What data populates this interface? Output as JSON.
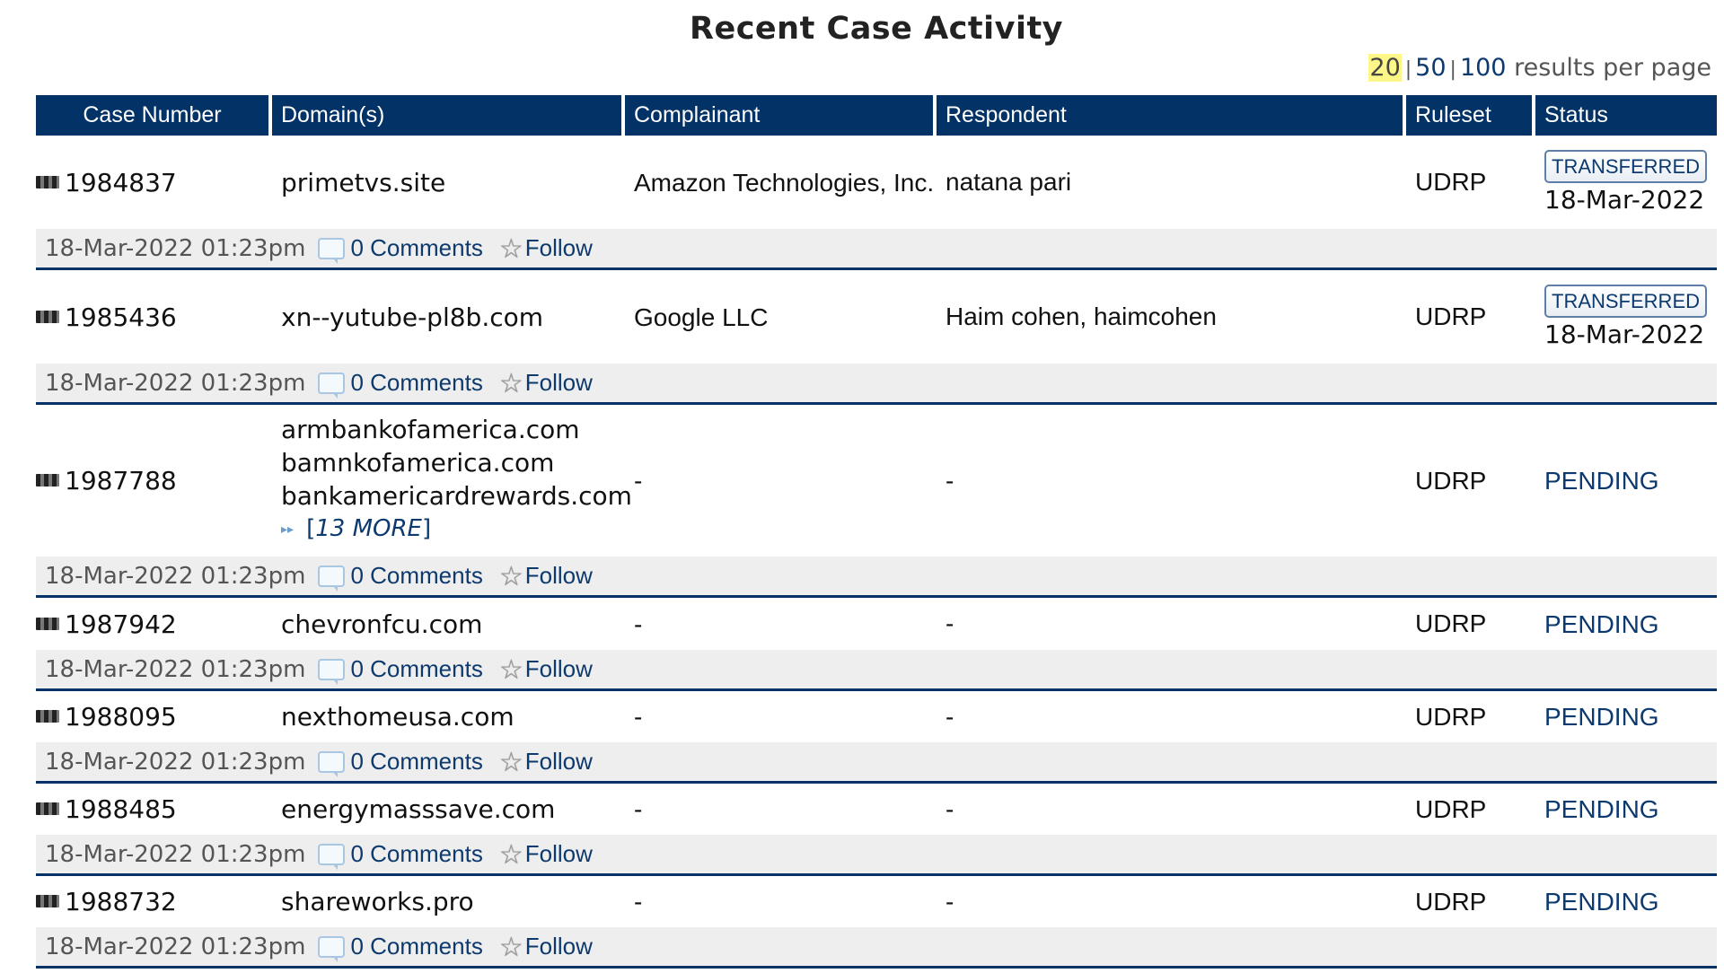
{
  "page": {
    "title": "Recent Case Activity"
  },
  "pagination": {
    "current": "20",
    "options": [
      "50",
      "100"
    ],
    "separator": "|",
    "suffix": "results per page",
    "highlight_color": "#fdf78a"
  },
  "table": {
    "headers": {
      "case_number": "Case Number",
      "domains": "Domain(s)",
      "complainant": "Complainant",
      "respondent": "Respondent",
      "ruleset": "Ruleset",
      "status": "Status"
    },
    "header_color": "#033366",
    "rows": [
      {
        "case_number": "1984837",
        "domains": [
          "primetvs.site"
        ],
        "more": null,
        "complainant": "Amazon Technologies, Inc.",
        "respondent": "natana pari",
        "ruleset": "UDRP",
        "status": "TRANSFERRED",
        "status_date": "18-Mar-2022",
        "timestamp": "18-Mar-2022 01:23pm",
        "comments": "0 Comments",
        "follow": "Follow"
      },
      {
        "case_number": "1985436",
        "domains": [
          "xn--yutube-pl8b.com"
        ],
        "more": null,
        "complainant": "Google LLC",
        "respondent": "Haim cohen, haimcohen",
        "ruleset": "UDRP",
        "status": "TRANSFERRED",
        "status_date": "18-Mar-2022",
        "timestamp": "18-Mar-2022 01:23pm",
        "comments": "0 Comments",
        "follow": "Follow"
      },
      {
        "case_number": "1987788",
        "domains": [
          "armbankofamerica.com",
          "bamnkofamerica.com",
          "bankamericardrewards.com"
        ],
        "more": "13 MORE",
        "complainant": "-",
        "respondent": "-",
        "ruleset": "UDRP",
        "status": "PENDING",
        "status_date": null,
        "timestamp": "18-Mar-2022 01:23pm",
        "comments": "0 Comments",
        "follow": "Follow"
      },
      {
        "case_number": "1987942",
        "domains": [
          "chevronfcu.com"
        ],
        "more": null,
        "complainant": "-",
        "respondent": "-",
        "ruleset": "UDRP",
        "status": "PENDING",
        "status_date": null,
        "timestamp": "18-Mar-2022 01:23pm",
        "comments": "0 Comments",
        "follow": "Follow"
      },
      {
        "case_number": "1988095",
        "domains": [
          "nexthomeusa.com"
        ],
        "more": null,
        "complainant": "-",
        "respondent": "-",
        "ruleset": "UDRP",
        "status": "PENDING",
        "status_date": null,
        "timestamp": "18-Mar-2022 01:23pm",
        "comments": "0 Comments",
        "follow": "Follow"
      },
      {
        "case_number": "1988485",
        "domains": [
          "energymasssave.com"
        ],
        "more": null,
        "complainant": "-",
        "respondent": "-",
        "ruleset": "UDRP",
        "status": "PENDING",
        "status_date": null,
        "timestamp": "18-Mar-2022 01:23pm",
        "comments": "0 Comments",
        "follow": "Follow"
      },
      {
        "case_number": "1988732",
        "domains": [
          "shareworks.pro"
        ],
        "more": null,
        "complainant": "-",
        "respondent": "-",
        "ruleset": "UDRP",
        "status": "PENDING",
        "status_date": null,
        "timestamp": "18-Mar-2022 01:23pm",
        "comments": "0 Comments",
        "follow": "Follow"
      }
    ]
  }
}
